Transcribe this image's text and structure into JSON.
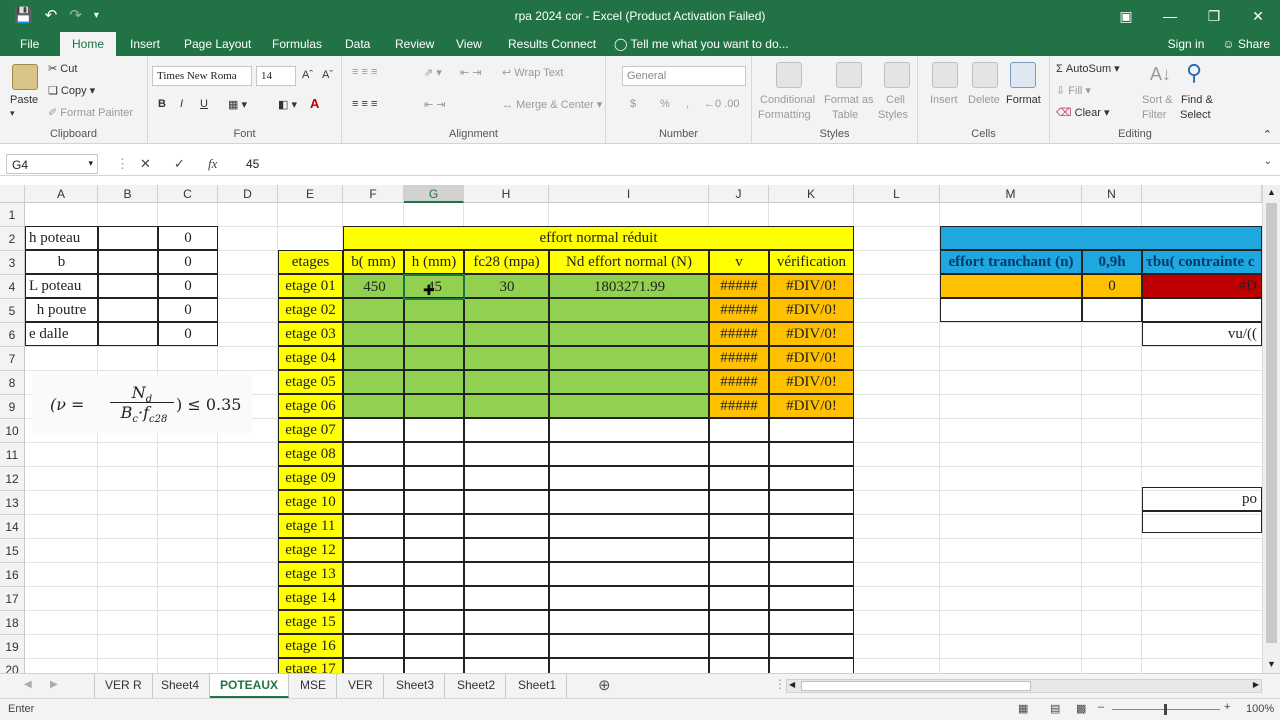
{
  "title_bar": {
    "title": "rpa 2024 cor - Excel (Product Activation Failed)"
  },
  "ribbon_tabs": [
    "File",
    "Home",
    "Insert",
    "Page Layout",
    "Formulas",
    "Data",
    "Review",
    "View",
    "Results Connect"
  ],
  "active_tab": "Home",
  "tell_me": "Tell me what you want to do...",
  "sign_in": "Sign in",
  "share": "Share",
  "clipboard": {
    "paste": "Paste",
    "cut": "Cut",
    "copy": "Copy",
    "format_painter": "Format Painter",
    "label": "Clipboard"
  },
  "font": {
    "name": "Times New Roma",
    "size": "14",
    "bold": "B",
    "italic": "I",
    "underline": "U",
    "label": "Font"
  },
  "alignment": {
    "wrap": "Wrap Text",
    "merge": "Merge & Center",
    "label": "Alignment"
  },
  "number": {
    "format": "General",
    "currency": "$",
    "percent": "%",
    "comma": ",",
    "label": "Number"
  },
  "styles": {
    "conditional": "Conditional",
    "conditional2": "Formatting",
    "format_as": "Format as",
    "format_as2": "Table",
    "cell": "Cell",
    "cell2": "Styles",
    "label": "Styles"
  },
  "cells": {
    "insert": "Insert",
    "delete": "Delete",
    "format": "Format",
    "label": "Cells"
  },
  "editing": {
    "autosum": "AutoSum",
    "fill": "Fill",
    "clear": "Clear",
    "sort": "Sort &",
    "sort2": "Filter",
    "find": "Find &",
    "find2": "Select",
    "label": "Editing"
  },
  "formula_bar": {
    "name_box": "G4",
    "value": "45",
    "fx": "fx"
  },
  "columns": [
    "A",
    "B",
    "C",
    "D",
    "E",
    "F",
    "G",
    "H",
    "I",
    "J",
    "K",
    "L",
    "M",
    "N",
    ""
  ],
  "rows": [
    "1",
    "2",
    "3",
    "4",
    "5",
    "6",
    "7",
    "8",
    "9",
    "10",
    "11",
    "12",
    "13",
    "14",
    "15",
    "16",
    "17",
    "18",
    "19",
    "20"
  ],
  "left_table": [
    {
      "label": "h poteau",
      "value": "0"
    },
    {
      "label": "b",
      "value": "0"
    },
    {
      "label": "L poteau",
      "value": "0"
    },
    {
      "label": "h poutre",
      "value": "0"
    },
    {
      "label": "e dalle",
      "value": "0"
    }
  ],
  "formula_image": {
    "lhs": "(ν =",
    "num": "N",
    "num_sub": "d",
    "den": "B",
    "den_sub": "c",
    "den2": "·f",
    "den2_sub": "c28",
    "rhs": ") ≤ 0.35"
  },
  "main_table": {
    "title": "effort normal réduit",
    "headers": [
      "etages",
      "b( mm)",
      "h (mm)",
      "fc28 (mpa)",
      "Nd effort normal (N)",
      "v",
      "vérification"
    ],
    "first_row": {
      "b": "450",
      "h": "45",
      "fc28": "30",
      "nd": "1803271.99",
      "v": "#####",
      "verif": "#DIV/0!"
    },
    "etages": [
      "etage 01",
      "etage 02",
      "etage 03",
      "etage 04",
      "etage 05",
      "etage 06",
      "etage 07",
      "etage 08",
      "etage 09",
      "etage 10",
      "etage 11",
      "etage 12",
      "etage 13",
      "etage 14",
      "etage 15",
      "etage 16",
      "etage 17"
    ],
    "v_error": "#####",
    "verif_error": "#DIV/0!"
  },
  "right_table": {
    "headers": [
      "effort tranchant (n)",
      "0,9h",
      "τbu( contrainte c"
    ],
    "n_value": "0",
    "red_value": "#D",
    "vu_text": "vu/((",
    "po_text": "po"
  },
  "sheets": [
    "VER R",
    "Sheet4",
    "POTEAUX",
    "MSE",
    "VER",
    "Sheet3",
    "Sheet2",
    "Sheet1"
  ],
  "active_sheet": "POTEAUX",
  "status": {
    "mode": "Enter",
    "zoom": "100%"
  },
  "colors": {
    "excel_green": "#217346",
    "yellow": "#ffff00",
    "green": "#92d050",
    "orange": "#ffc000",
    "blue": "#1fa7e0",
    "red": "#c00000"
  }
}
